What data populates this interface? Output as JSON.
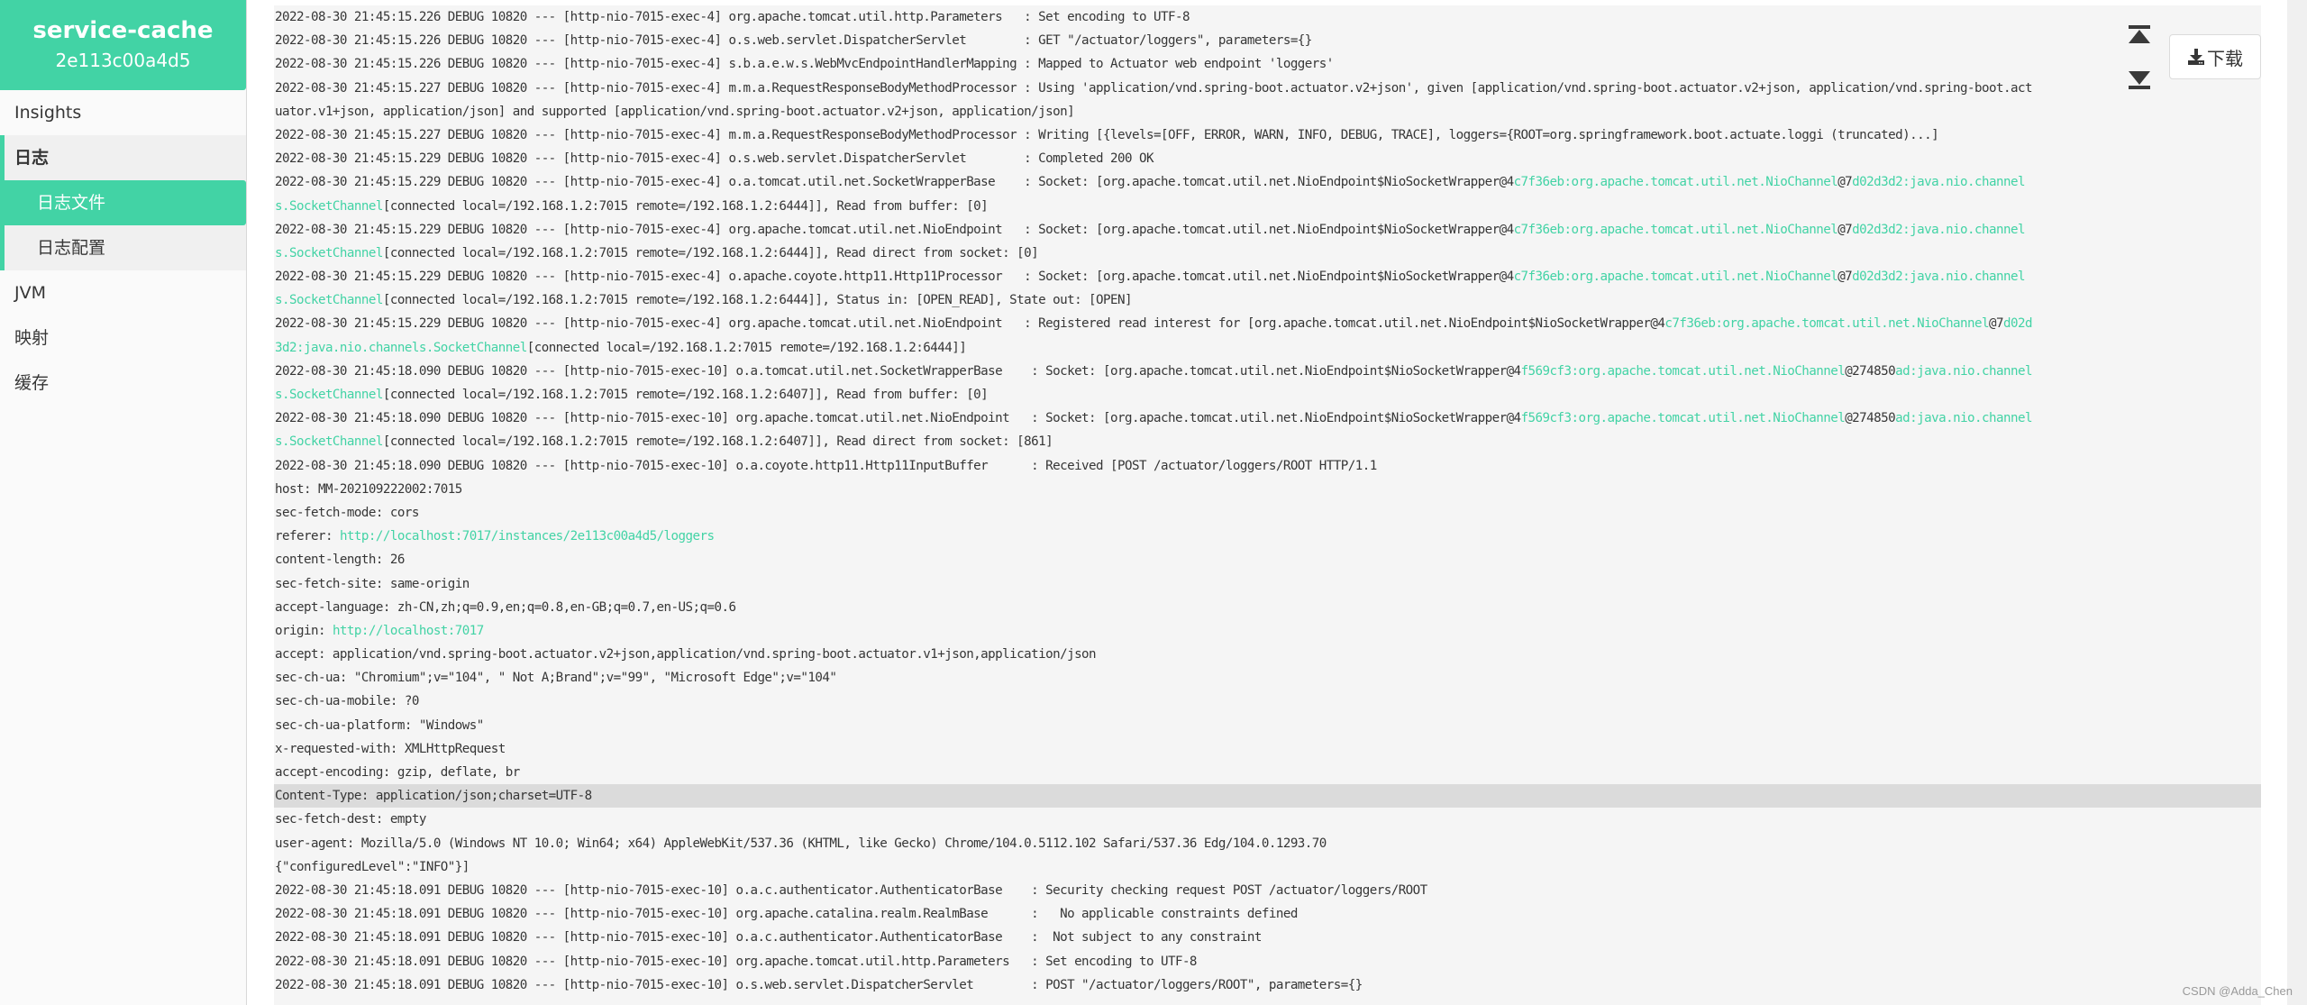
{
  "app": {
    "name": "service-cache",
    "instance_id": "2e113c00a4d5"
  },
  "sidebar": {
    "items": [
      {
        "label": "Insights"
      },
      {
        "label": "日志",
        "children": [
          {
            "label": "日志文件",
            "active": true
          },
          {
            "label": "日志配置"
          }
        ]
      },
      {
        "label": "JVM"
      },
      {
        "label": "映射"
      },
      {
        "label": "缓存"
      }
    ]
  },
  "toolbar": {
    "scroll_top_icon": "scroll-to-top-icon",
    "scroll_bottom_icon": "scroll-to-bottom-icon",
    "download_label": "下载",
    "download_icon": "download-icon"
  },
  "colors": {
    "accent": "#42d3a5",
    "log_background": "#f5f5f5",
    "highlight_row": "#dbdbdb",
    "text": "#363636"
  },
  "log": {
    "lines": [
      [
        {
          "t": "2022-08-30 21:45:15.226 DEBUG 10820 --- [http-nio-7015-exec-4] org.apache.tomcat.util.http.Parameters   : Set encoding to UTF-8"
        }
      ],
      [
        {
          "t": "2022-08-30 21:45:15.226 DEBUG 10820 --- [http-nio-7015-exec-4] o.s.web.servlet.DispatcherServlet        : GET \"/actuator/loggers\", parameters={}"
        }
      ],
      [
        {
          "t": "2022-08-30 21:45:15.226 DEBUG 10820 --- [http-nio-7015-exec-4] s.b.a.e.w.s.WebMvcEndpointHandlerMapping : Mapped to Actuator web endpoint 'loggers'"
        }
      ],
      [
        {
          "t": "2022-08-30 21:45:15.227 DEBUG 10820 --- [http-nio-7015-exec-4] m.m.a.RequestResponseBodyMethodProcessor : Using 'application/vnd.spring-boot.actuator.v2+json', given [application/vnd.spring-boot.actuator.v2+json, application/vnd.spring-boot.act"
        }
      ],
      [
        {
          "t": "uator.v1+json, application/json] and supported [application/vnd.spring-boot.actuator.v2+json, application/json]"
        }
      ],
      [
        {
          "t": "2022-08-30 21:45:15.227 DEBUG 10820 --- [http-nio-7015-exec-4] m.m.a.RequestResponseBodyMethodProcessor : Writing [{levels=[OFF, ERROR, WARN, INFO, DEBUG, TRACE], loggers={ROOT=org.springframework.boot.actuate.loggi (truncated)...]"
        }
      ],
      [
        {
          "t": "2022-08-30 21:45:15.229 DEBUG 10820 --- [http-nio-7015-exec-4] o.s.web.servlet.DispatcherServlet        : Completed 200 OK"
        }
      ],
      [
        {
          "t": "2022-08-30 21:45:15.229 DEBUG 10820 --- [http-nio-7015-exec-4] o.a.tomcat.util.net.SocketWrapperBase    : Socket: [org.apache.tomcat.util.net.NioEndpoint$NioSocketWrapper@4"
        },
        {
          "t": "c7f36eb:org.apache.tomcat.util.net.NioChannel",
          "g": true
        },
        {
          "t": "@7"
        },
        {
          "t": "d02d3d2:java.nio.channel",
          "g": true
        }
      ],
      [
        {
          "t": "s.SocketChannel",
          "g": true
        },
        {
          "t": "[connected local=/192.168.1.2:7015 remote=/192.168.1.2:6444]], Read from buffer: [0]"
        }
      ],
      [
        {
          "t": "2022-08-30 21:45:15.229 DEBUG 10820 --- [http-nio-7015-exec-4] org.apache.tomcat.util.net.NioEndpoint   : Socket: [org.apache.tomcat.util.net.NioEndpoint$NioSocketWrapper@4"
        },
        {
          "t": "c7f36eb:org.apache.tomcat.util.net.NioChannel",
          "g": true
        },
        {
          "t": "@7"
        },
        {
          "t": "d02d3d2:java.nio.channel",
          "g": true
        }
      ],
      [
        {
          "t": "s.SocketChannel",
          "g": true
        },
        {
          "t": "[connected local=/192.168.1.2:7015 remote=/192.168.1.2:6444]], Read direct from socket: [0]"
        }
      ],
      [
        {
          "t": "2022-08-30 21:45:15.229 DEBUG 10820 --- [http-nio-7015-exec-4] o.apache.coyote.http11.Http11Processor   : Socket: [org.apache.tomcat.util.net.NioEndpoint$NioSocketWrapper@4"
        },
        {
          "t": "c7f36eb:org.apache.tomcat.util.net.NioChannel",
          "g": true
        },
        {
          "t": "@7"
        },
        {
          "t": "d02d3d2:java.nio.channel",
          "g": true
        }
      ],
      [
        {
          "t": "s.SocketChannel",
          "g": true
        },
        {
          "t": "[connected local=/192.168.1.2:7015 remote=/192.168.1.2:6444]], Status in: [OPEN_READ], State out: [OPEN]"
        }
      ],
      [
        {
          "t": "2022-08-30 21:45:15.229 DEBUG 10820 --- [http-nio-7015-exec-4] org.apache.tomcat.util.net.NioEndpoint   : Registered read interest for [org.apache.tomcat.util.net.NioEndpoint$NioSocketWrapper@4"
        },
        {
          "t": "c7f36eb:org.apache.tomcat.util.net.NioChannel",
          "g": true
        },
        {
          "t": "@7"
        },
        {
          "t": "d02d",
          "g": true
        }
      ],
      [
        {
          "t": "3d2:java.nio.channels.SocketChannel",
          "g": true
        },
        {
          "t": "[connected local=/192.168.1.2:7015 remote=/192.168.1.2:6444]]"
        }
      ],
      [
        {
          "t": "2022-08-30 21:45:18.090 DEBUG 10820 --- [http-nio-7015-exec-10] o.a.tomcat.util.net.SocketWrapperBase    : Socket: [org.apache.tomcat.util.net.NioEndpoint$NioSocketWrapper@4"
        },
        {
          "t": "f569cf3:org.apache.tomcat.util.net.NioChannel",
          "g": true
        },
        {
          "t": "@274850"
        },
        {
          "t": "ad:java.nio.channel",
          "g": true
        }
      ],
      [
        {
          "t": "s.SocketChannel",
          "g": true
        },
        {
          "t": "[connected local=/192.168.1.2:7015 remote=/192.168.1.2:6407]], Read from buffer: [0]"
        }
      ],
      [
        {
          "t": "2022-08-30 21:45:18.090 DEBUG 10820 --- [http-nio-7015-exec-10] org.apache.tomcat.util.net.NioEndpoint   : Socket: [org.apache.tomcat.util.net.NioEndpoint$NioSocketWrapper@4"
        },
        {
          "t": "f569cf3:org.apache.tomcat.util.net.NioChannel",
          "g": true
        },
        {
          "t": "@274850"
        },
        {
          "t": "ad:java.nio.channel",
          "g": true
        }
      ],
      [
        {
          "t": "s.SocketChannel",
          "g": true
        },
        {
          "t": "[connected local=/192.168.1.2:7015 remote=/192.168.1.2:6407]], Read direct from socket: [861]"
        }
      ],
      [
        {
          "t": "2022-08-30 21:45:18.090 DEBUG 10820 --- [http-nio-7015-exec-10] o.a.coyote.http11.Http11InputBuffer      : Received [POST /actuator/loggers/ROOT HTTP/1.1"
        }
      ],
      [
        {
          "t": "host: MM-202109222002:7015"
        }
      ],
      [
        {
          "t": "sec-fetch-mode: cors"
        }
      ],
      [
        {
          "t": "referer: "
        },
        {
          "t": "http://localhost:7017/instances/2e113c00a4d5/loggers",
          "g": true
        }
      ],
      [
        {
          "t": "content-length: 26"
        }
      ],
      [
        {
          "t": "sec-fetch-site: same-origin"
        }
      ],
      [
        {
          "t": "accept-language: zh-CN,zh;q=0.9,en;q=0.8,en-GB;q=0.7,en-US;q=0.6"
        }
      ],
      [
        {
          "t": "origin: "
        },
        {
          "t": "http://localhost:7017",
          "g": true
        }
      ],
      [
        {
          "t": "accept: application/vnd.spring-boot.actuator.v2+json,application/vnd.spring-boot.actuator.v1+json,application/json"
        }
      ],
      [
        {
          "t": "sec-ch-ua: \"Chromium\";v=\"104\", \" Not A;Brand\";v=\"99\", \"Microsoft Edge\";v=\"104\""
        }
      ],
      [
        {
          "t": "sec-ch-ua-mobile: ?0"
        }
      ],
      [
        {
          "t": "sec-ch-ua-platform: \"Windows\""
        }
      ],
      [
        {
          "t": "x-requested-with: XMLHttpRequest"
        }
      ],
      [
        {
          "t": "accept-encoding: gzip, deflate, br"
        }
      ],
      [
        {
          "t": "Content-Type: application/json;charset=UTF-8",
          "hl": true
        }
      ],
      [
        {
          "t": "sec-fetch-dest: empty"
        }
      ],
      [
        {
          "t": "user-agent: Mozilla/5.0 (Windows NT 10.0; Win64; x64) AppleWebKit/537.36 (KHTML, like Gecko) Chrome/104.0.5112.102 Safari/537.36 Edg/104.0.1293.70"
        }
      ],
      [
        {
          "t": "{\"configuredLevel\":\"INFO\"}]"
        }
      ],
      [
        {
          "t": "2022-08-30 21:45:18.091 DEBUG 10820 --- [http-nio-7015-exec-10] o.a.c.authenticator.AuthenticatorBase    : Security checking request POST /actuator/loggers/ROOT"
        }
      ],
      [
        {
          "t": "2022-08-30 21:45:18.091 DEBUG 10820 --- [http-nio-7015-exec-10] org.apache.catalina.realm.RealmBase      :   No applicable constraints defined"
        }
      ],
      [
        {
          "t": "2022-08-30 21:45:18.091 DEBUG 10820 --- [http-nio-7015-exec-10] o.a.c.authenticator.AuthenticatorBase    :  Not subject to any constraint"
        }
      ],
      [
        {
          "t": "2022-08-30 21:45:18.091 DEBUG 10820 --- [http-nio-7015-exec-10] org.apache.tomcat.util.http.Parameters   : Set encoding to UTF-8"
        }
      ],
      [
        {
          "t": "2022-08-30 21:45:18.091 DEBUG 10820 --- [http-nio-7015-exec-10] o.s.web.servlet.DispatcherServlet        : POST \"/actuator/loggers/ROOT\", parameters={}"
        }
      ]
    ]
  },
  "watermark": "CSDN @Adda_Chen"
}
